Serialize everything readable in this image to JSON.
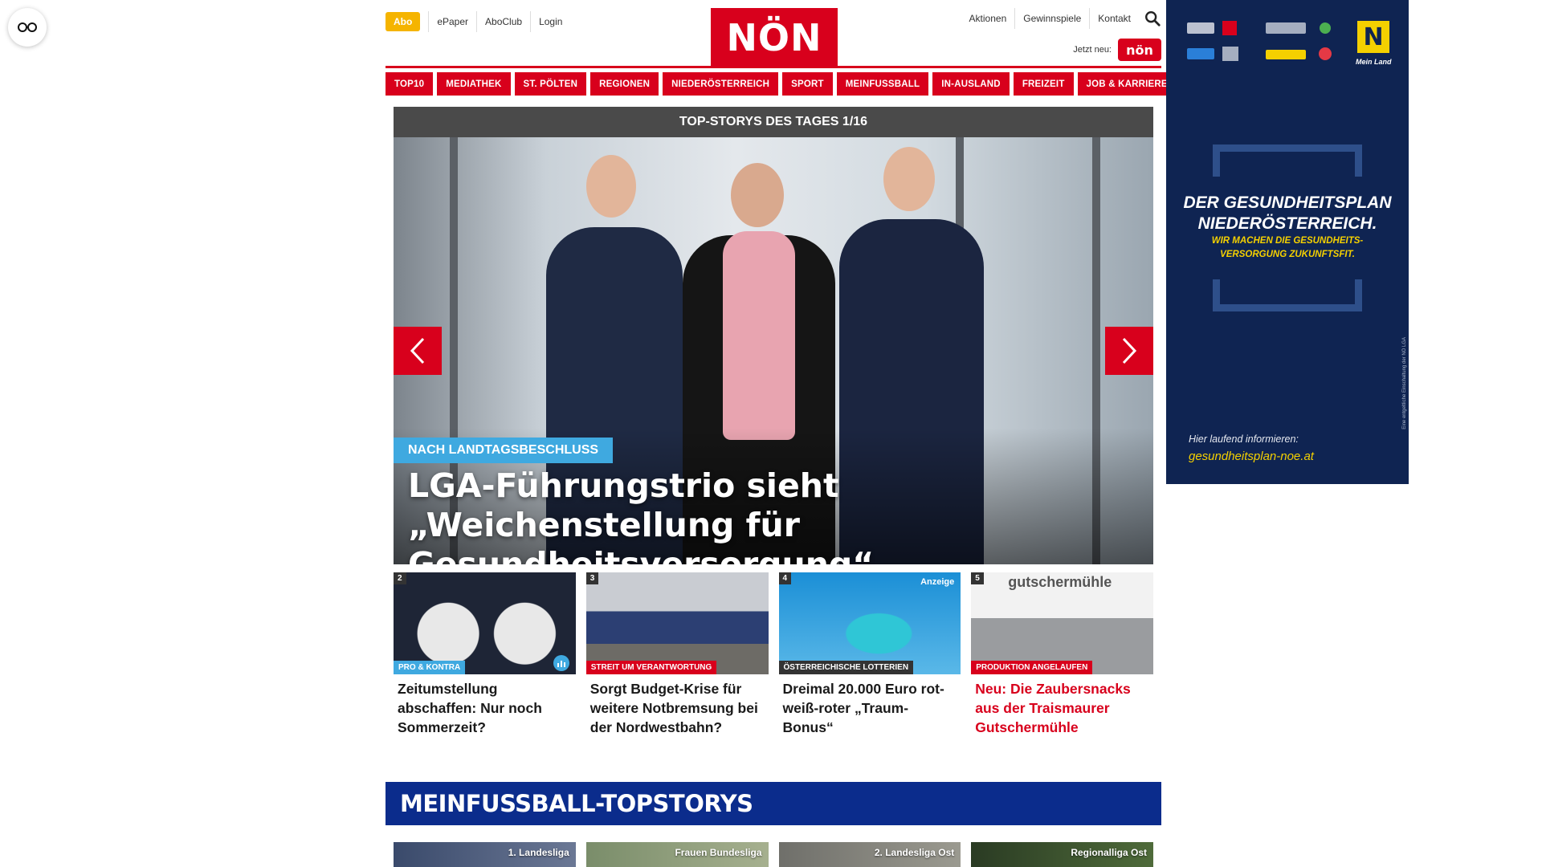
{
  "header": {
    "abo_label": "Abo",
    "top_links": [
      "ePaper",
      "AboClub",
      "Login"
    ],
    "logo_text": "NÖN",
    "right_links": [
      "Aktionen",
      "Gewinnspiele",
      "Kontakt"
    ],
    "jetzt_neu_label": "Jetzt neu:",
    "kleine_noen_text": "nön"
  },
  "nav": {
    "items": [
      "TOP10",
      "MEDIATHEK",
      "ST. PÖLTEN",
      "REGIONEN",
      "NIEDERÖSTERREICH",
      "SPORT",
      "MEINFUSSBALL",
      "IN-AUSLAND",
      "FREIZEIT",
      "JOB & KARRIERE"
    ]
  },
  "carousel": {
    "heading": "TOP-STORYS DES TAGES 1/16",
    "kicker": "NACH LANDTAGSBESCHLUSS",
    "headline": "LGA-Führungstrio sieht „Weichenstellung für Gesundheitsversorgung“"
  },
  "teasers": [
    {
      "number": "2",
      "tag": "PRO & KONTRA",
      "tag_color": "#3fa9e0",
      "title": "Zeitumstellung abschaffen: Nur noch Sommerzeit?",
      "title_red": false
    },
    {
      "number": "3",
      "tag": "STREIT UM VERANTWORTUNG",
      "tag_color": "#d8001c",
      "title": "Sorgt Budget-Krise für weitere Notbremsung bei der Nordwestbahn?",
      "title_red": false
    },
    {
      "number": "4",
      "tag": "ÖSTERREICHISCHE LOTTERIEN",
      "tag_color": "#333333",
      "badge": "Anzeige",
      "title": "Dreimal 20.000 Euro rot-weiß-roter „Traum-Bonus“",
      "title_red": false
    },
    {
      "number": "5",
      "tag": "PRODUKTION ANGELAUFEN",
      "tag_color": "#d8001c",
      "image_text": "gutschermühle",
      "title": "Neu: Die Zaubersnacks aus der Traismaurer Gutschermühle",
      "title_red": true
    }
  ],
  "section": {
    "title": "MEINFUSSBALL-TOPSTORYS",
    "leagues": [
      "1. Landesliga",
      "Frauen Bundesliga",
      "2. Landesliga Ost",
      "Regionalliga Ost"
    ]
  },
  "ad": {
    "title_line1": "DER GESUNDHEITSPLAN",
    "title_line2": "NIEDERÖSTERREICH.",
    "sub_line1": "WIR MACHEN DIE GESUNDHEITS-",
    "sub_line2": "VERSORGUNG ZUKUNFTSFIT.",
    "info": "Hier laufend informieren:",
    "url": "gesundheitsplan-noe.at",
    "vertical": "Eine entgeltliche Einschaltung der NÖ LGA",
    "mein_land": "Mein Land",
    "n_logo": "N"
  },
  "colors": {
    "brand_red": "#d8001c",
    "abo_yellow": "#f5b400",
    "section_blue": "#0b2c8c",
    "ad_navy": "#0f2452",
    "ad_yellow": "#f4d000"
  }
}
